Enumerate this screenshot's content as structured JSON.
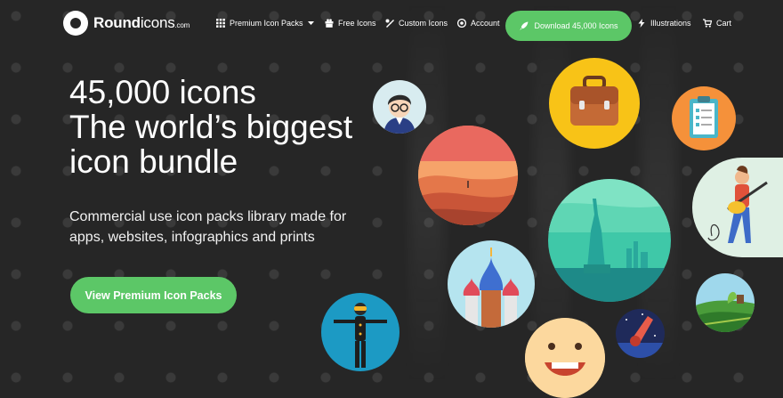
{
  "brand": {
    "name_bold": "Round",
    "name_light": "icons",
    "suffix": ".com"
  },
  "nav": {
    "premium": "Premium Icon Packs",
    "free": "Free Icons",
    "custom": "Custom Icons",
    "account": "Account",
    "download": "Download 45,000 Icons",
    "illustrations": "Illustrations",
    "cart": "Cart"
  },
  "hero": {
    "line1": "45,000 icons",
    "line2": "The world’s biggest",
    "line3": "icon bundle",
    "subtitle": "Commercial use icon packs library made for apps, websites, infographics and prints",
    "cta": "View Premium Icon Packs"
  },
  "colors": {
    "background": "#262626",
    "accent": "#5cc767"
  },
  "icons": [
    "nerd-avatar-icon",
    "briefcase-icon",
    "clipboard-icon",
    "desert-icon",
    "statue-of-liberty-icon",
    "guitarist-icon",
    "cathedral-icon",
    "vr-person-icon",
    "smiley-face-icon",
    "meteor-icon",
    "farm-field-icon"
  ]
}
